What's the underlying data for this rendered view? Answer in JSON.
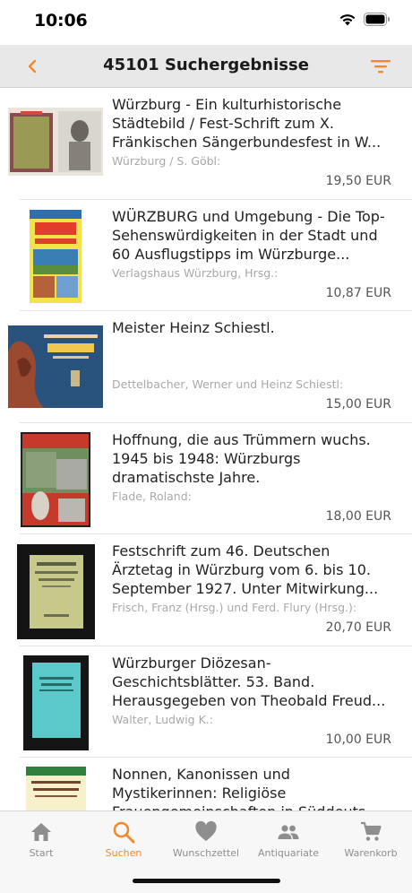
{
  "status": {
    "time": "10:06"
  },
  "nav": {
    "title": "45101 Suchergebnisse"
  },
  "colors": {
    "accent": "#f08a2c",
    "tab_inactive": "#8e8e8e",
    "author": "#a8a8a8",
    "nav_bg": "#e8e8e8"
  },
  "icons": {
    "back": "chevron-left-icon",
    "filter": "filter-icon"
  },
  "results": [
    {
      "title": "Würzburg - Ein kulturhistorische Städtebild / Fest-Schrift zum X. Fränkischen Sängerbundesfest in W...",
      "author": "Würzburg / S. Göbl:",
      "price": "19,50 EUR"
    },
    {
      "title": "WÜRZBURG und Umgebung - Die Top-Sehenswürdigkeiten in der Stadt und 60 Ausflugstipps im Würzburge...",
      "author": "Verlagshaus Würzburg, Hrsg.:",
      "price": "10,87 EUR"
    },
    {
      "title": "Meister Heinz Schiestl.",
      "author": "Dettelbacher, Werner und Heinz Schiestl:",
      "price": "15,00 EUR"
    },
    {
      "title": "Hoffnung, die aus Trümmern wuchs. 1945 bis 1948: Würzburgs dramatischste Jahre.",
      "author": "Flade, Roland:",
      "price": "18,00 EUR"
    },
    {
      "title": "Festschrift zum 46. Deutschen Ärztetag in Würzburg vom 6. bis 10. September 1927. Unter Mitwirkung...",
      "author": "Frisch, Franz (Hrsg.) und Ferd. Flury (Hrsg.):",
      "price": "20,70 EUR"
    },
    {
      "title": "Würzburger Diözesan-Geschichtsblätter. 53. Band. Herausgegeben von Theobald Freud...",
      "author": "Walter, Ludwig K.:",
      "price": "10,00 EUR"
    },
    {
      "title": "Nonnen, Kanonissen und Mystikerinnen: Religiöse Frauengemeinschaften in Süddeuts...",
      "author": "",
      "price": ""
    }
  ],
  "tabs": [
    {
      "label": "Start",
      "icon": "home-icon"
    },
    {
      "label": "Suchen",
      "icon": "search-icon",
      "active": true
    },
    {
      "label": "Wunschzettel",
      "icon": "heart-icon"
    },
    {
      "label": "Antiquariate",
      "icon": "people-icon"
    },
    {
      "label": "Warenkorb",
      "icon": "cart-icon"
    }
  ]
}
